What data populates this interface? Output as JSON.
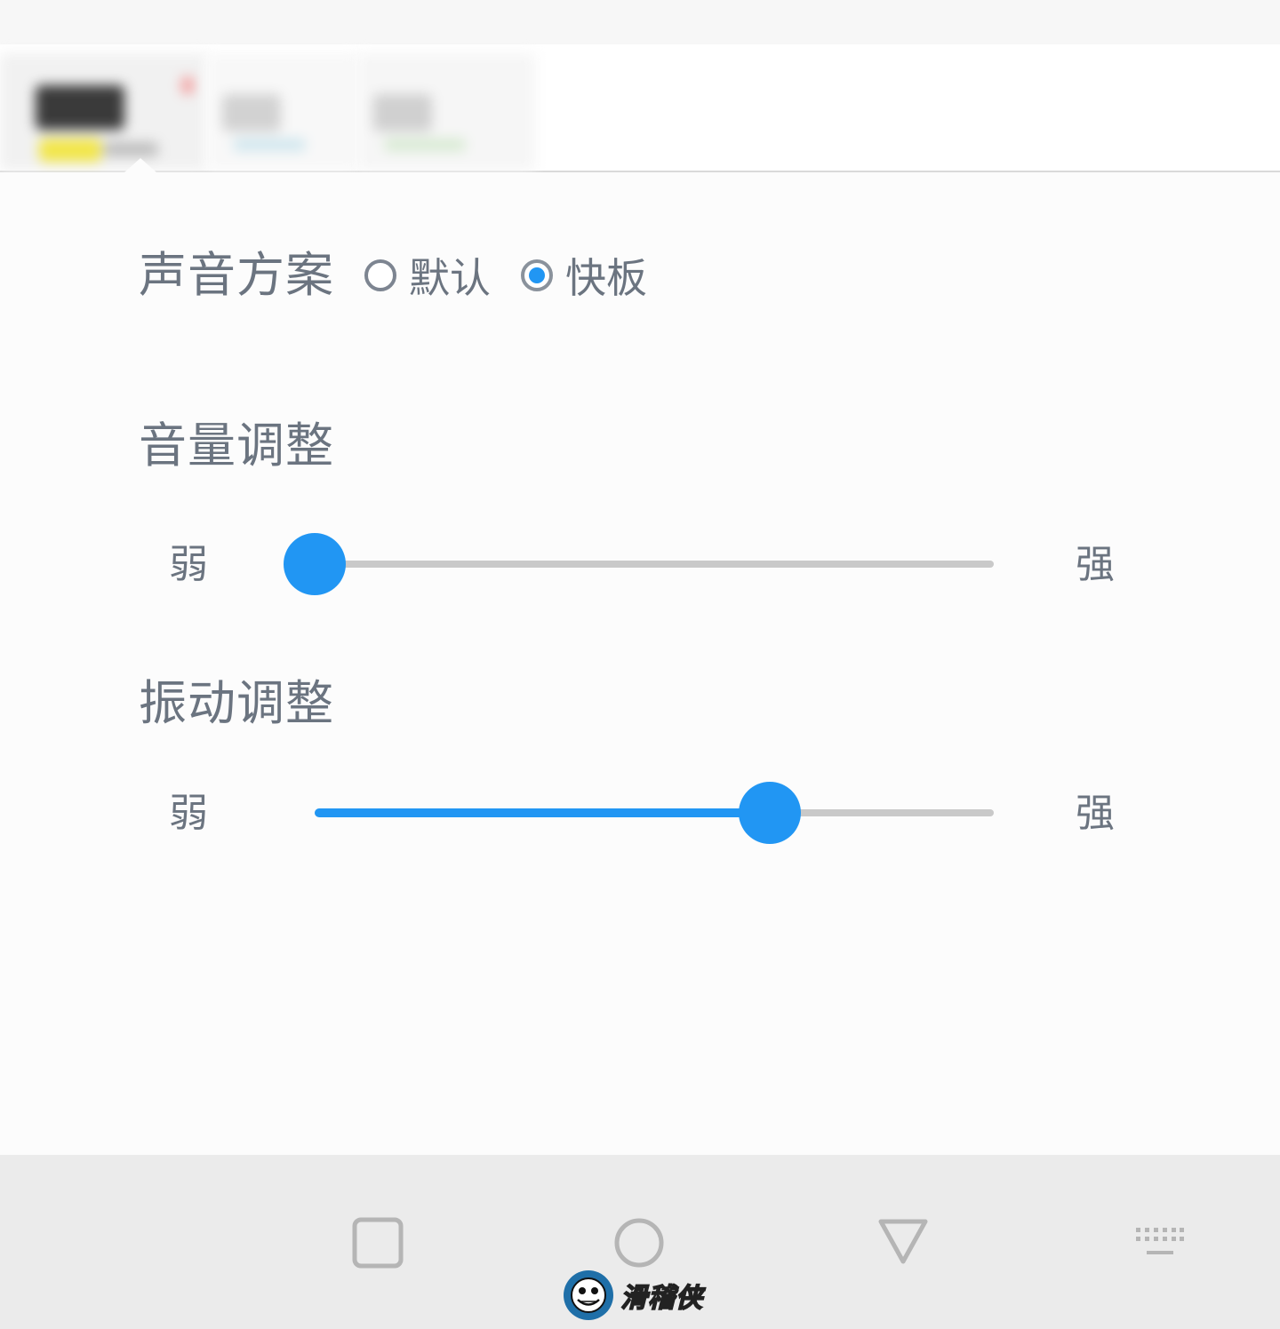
{
  "sound_scheme": {
    "title": "声音方案",
    "options": [
      {
        "label": "默认",
        "selected": false
      },
      {
        "label": "快板",
        "selected": true
      }
    ]
  },
  "volume": {
    "title": "音量调整",
    "min_label": "弱",
    "max_label": "强",
    "level": 0.0
  },
  "vibration": {
    "title": "振动调整",
    "min_label": "弱",
    "max_label": "强",
    "level": 0.67
  },
  "watermark": {
    "text": "滑稽侠"
  },
  "colors": {
    "accent": "#2196f3",
    "text": "#6b7480",
    "track": "#c9c9c9",
    "nav_bar": "#ebebeb"
  },
  "icons": {
    "nav": [
      "square-recent-icon",
      "circle-home-icon",
      "triangle-back-icon",
      "keyboard-icon"
    ]
  }
}
